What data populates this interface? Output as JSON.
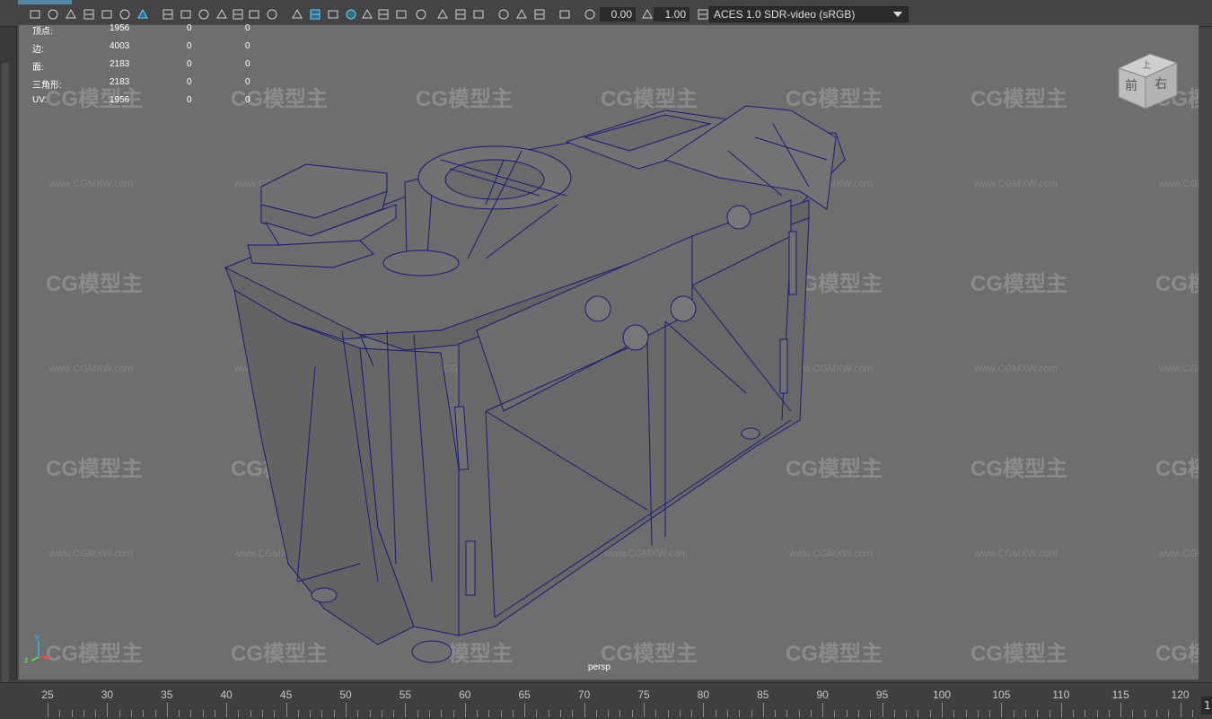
{
  "toolbar": {
    "exposure_value": "0.00",
    "gamma_value": "1.00",
    "color_space": "ACES 1.0 SDR-video (sRGB)",
    "icons": [
      "camera-icon",
      "camera-attributes-icon",
      "bookmark-icon",
      "image-plane-icon",
      "grid-icon",
      "film-gate-icon",
      "resolution-gate-icon",
      "gate-mask-icon",
      "field-chart-icon",
      "safe-action-icon",
      "safe-title-icon",
      "wireframe-icon",
      "smooth-shade-icon",
      "textured-icon",
      "use-lights-icon",
      "shadows-icon",
      "ambient-occlusion-icon",
      "motion-blur-icon",
      "anti-alias-icon",
      "depth-of-field-icon",
      "isolate-select-icon",
      "xray-icon",
      "xray-joints-icon",
      "backface-icon",
      "exposure-icon",
      "gamma-icon",
      "color-management-icon"
    ]
  },
  "hud": {
    "rows": [
      {
        "label": "顶点:",
        "v1": "1956",
        "v2": "0",
        "v3": "0"
      },
      {
        "label": "边:",
        "v1": "4003",
        "v2": "0",
        "v3": "0"
      },
      {
        "label": "面:",
        "v1": "2183",
        "v2": "0",
        "v3": "0"
      },
      {
        "label": "三角形:",
        "v1": "2183",
        "v2": "0",
        "v3": "0"
      },
      {
        "label": "UV:",
        "v1": "1956",
        "v2": "0",
        "v3": "0"
      }
    ]
  },
  "viewcube": {
    "front": "前",
    "right": "右",
    "top": "上"
  },
  "camera_label": "persp",
  "axis": {
    "x": "x",
    "y": "y",
    "z": "z"
  },
  "watermark": {
    "logo": "CG模型主",
    "url": "www.CGMXW.com"
  },
  "timeline": {
    "ticks": [
      "25",
      "30",
      "35",
      "40",
      "45",
      "50",
      "55",
      "60",
      "65",
      "70",
      "75",
      "80",
      "85",
      "90",
      "95",
      "100",
      "105",
      "110",
      "115",
      "120"
    ],
    "current_frame": "1"
  },
  "colors": {
    "wire": "#1a1a7a",
    "viewport_bg": "#6e6e6e",
    "accent": "#5285a6"
  }
}
